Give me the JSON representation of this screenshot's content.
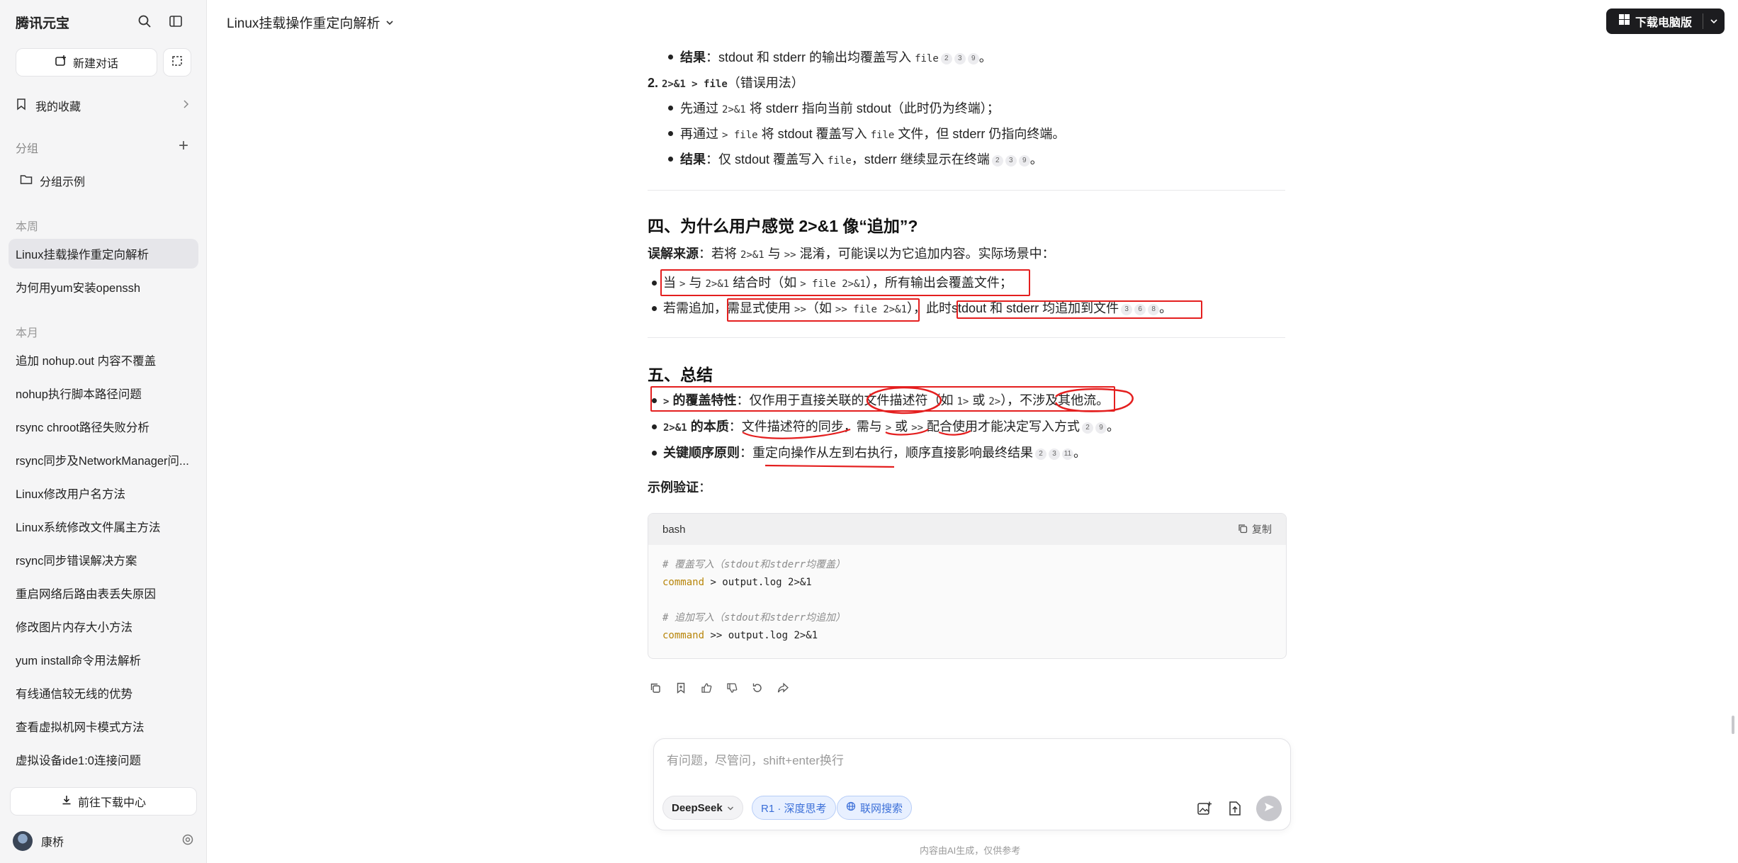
{
  "sidebar": {
    "brand": "腾讯元宝",
    "new_chat": "新建对话",
    "favorites": "我的收藏",
    "group_title": "分组",
    "group_item": "分组示例",
    "section_week": "本周",
    "section_month": "本月",
    "week_items": [
      "Linux挂载操作重定向解析",
      "为何用yum安装openssh"
    ],
    "month_items": [
      "追加 nohup.out 内容不覆盖",
      "nohup执行脚本路径问题",
      "rsync chroot路径失败分析",
      "rsync同步及NetworkManager问...",
      "Linux修改用户名方法",
      "Linux系统修改文件属主方法",
      "rsync同步错误解决方案",
      "重启网络后路由表丢失原因",
      "修改图片内存大小方法",
      "yum install命令用法解析",
      "有线通信较无线的优势",
      "查看虚拟机网卡模式方法",
      "虚拟设备ide1:0连接问题"
    ],
    "download_center": "前往下载中心",
    "user_name": "康桥"
  },
  "header": {
    "title": "Linux挂载操作重定向解析",
    "download_btn": "下载电脑版"
  },
  "content": {
    "l1_bold": "结果",
    "l1_text": "：stdout 和 stderr 的输出均覆盖写入 ",
    "l1_code": "file",
    "l1_cites": [
      "2",
      "3",
      "9"
    ],
    "l1_end": "。",
    "item2_num": "2.",
    "item2_code": "2>&1 > file",
    "item2_text": "（错误用法）",
    "l3_a": "先通过 ",
    "l3_code": "2>&1",
    "l3_b": " 将 stderr 指向当前 stdout（此时仍为终端）；",
    "l4_a": "再通过 ",
    "l4_code1": "> file",
    "l4_b": " 将 stdout 覆盖写入 ",
    "l4_code2": "file",
    "l4_c": " 文件，但 stderr 仍指向终端。",
    "l5_bold": "结果",
    "l5_a": "：仅 stdout 覆盖写入 ",
    "l5_code": "file",
    "l5_b": "，stderr 继续显示在终端",
    "l5_cites": [
      "2",
      "3",
      "9"
    ],
    "l5_end": "。",
    "h4": "四、为什么用户感觉 2>&1 像“追加”?",
    "s4_bold": "误解来源",
    "s4_a": "：若将 ",
    "s4_code1": "2>&1",
    "s4_b": " 与 ",
    "s4_code2": ">>",
    "s4_c": " 混淆，可能误以为它追加内容。实际场景中：",
    "b1_a": "当 ",
    "b1_code1": ">",
    "b1_b": " 与 ",
    "b1_code2": "2>&1",
    "b1_c": " 结合时（如 ",
    "b1_code3": "> file 2>&1",
    "b1_d": "），所有输出会覆盖文件；",
    "b2_a": "若需追加，",
    "b2_b": "需显式使用 ",
    "b2_code1": ">>",
    "b2_c": "（如 ",
    "b2_code2": ">> file 2>&1",
    "b2_d": "），此时",
    "b2_e": "stdout 和 stderr 均追加到文件",
    "b2_cites": [
      "3",
      "6",
      "8"
    ],
    "b2_end": "。",
    "h5": "五、总结",
    "t1_code": ">",
    "t1_bold": " 的覆盖特性",
    "t1_a": "：仅作用于直接关联的文件描述符（如 ",
    "t1_code2": "1>",
    "t1_b": " 或 ",
    "t1_code3": "2>",
    "t1_c": "），不涉及其他流。",
    "t2_code": "2>&1",
    "t2_bold": " 的本质",
    "t2_a": "：文件描述符的同步，需与 ",
    "t2_code2": ">",
    "t2_b": " 或 ",
    "t2_code3": ">>",
    "t2_c": " 配合使用才能决定写入方式",
    "t2_cites": [
      "2",
      "9"
    ],
    "t2_end": "。",
    "t3_bold": "关键顺序原则",
    "t3_a": "：重定向操作从左到右执行，顺序直接影响最终结果",
    "t3_cites": [
      "2",
      "3",
      "11"
    ],
    "t3_end": "。",
    "example_label": "示例验证",
    "example_colon": "："
  },
  "code": {
    "lang": "bash",
    "copy": "复制",
    "c1": "# 覆盖写入（stdout和stderr均覆盖）",
    "l1_kw": "command",
    "l1_rest": " > output.log 2>&1",
    "c2": "# 追加写入（stdout和stderr均追加）",
    "l2_kw": "command",
    "l2_rest": " >> output.log 2>&1"
  },
  "input": {
    "placeholder": "有问题，尽管问，shift+enter换行",
    "model": "DeepSeek",
    "r1": "R1 · 深度思考",
    "web": "联网搜索",
    "footer": "内容由AI生成，仅供参考"
  },
  "colors": {
    "annotation": "#e41f1f",
    "accent": "#3b6fd8",
    "dark_button": "#1c1c1f"
  }
}
